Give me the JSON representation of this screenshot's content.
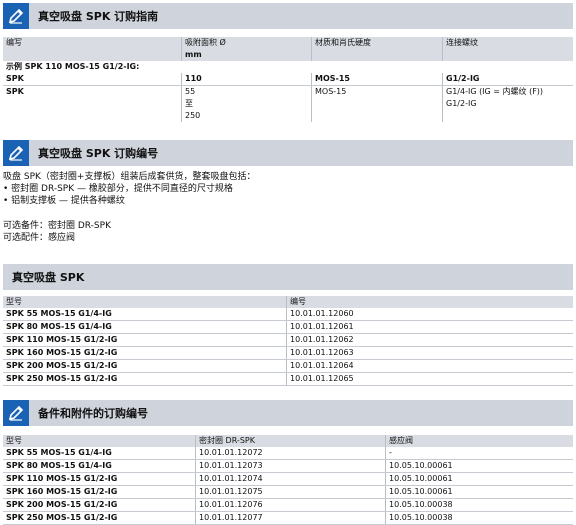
{
  "s1": {
    "title": "真空吸盘 SPK 订购指南",
    "headers": [
      "编写",
      "吸附面积 Ø",
      "材质和肖氏硬度",
      "连接螺纹"
    ],
    "header_unit": "mm",
    "example_label": "示例 SPK 110 MOS-15 G1/2-IG:",
    "example_row": [
      "SPK",
      "110",
      "MOS-15",
      "G1/2-IG"
    ],
    "spec_row": {
      "c1": "SPK",
      "c2": [
        "55",
        "至",
        "250"
      ],
      "c3": "MOS-15",
      "c4": [
        "G1/4-IG (IG = 内螺纹 (F))",
        "G1/2-IG"
      ]
    }
  },
  "s2": {
    "title": "真空吸盘 SPK 订购编号",
    "intro": "吸盘 SPK（密封圈+支撑板）组装后成套供货，整套吸盘包括：",
    "bullets": [
      "• 密封圈 DR-SPK — 橡胶部分，提供不同直径的尺寸规格",
      "• 铝制支撑板 — 提供各种螺纹"
    ],
    "spare": "可选备件：密封圈 DR-SPK",
    "accessory": "可选配件：感应阀"
  },
  "s3": {
    "title": "真空吸盘 SPK",
    "headers": [
      "型号",
      "编号"
    ],
    "rows": [
      [
        "SPK 55 MOS-15 G1/4-IG",
        "10.01.01.12060"
      ],
      [
        "SPK 80 MOS-15 G1/4-IG",
        "10.01.01.12061"
      ],
      [
        "SPK 110 MOS-15 G1/2-IG",
        "10.01.01.12062"
      ],
      [
        "SPK 160 MOS-15 G1/2-IG",
        "10.01.01.12063"
      ],
      [
        "SPK 200 MOS-15 G1/2-IG",
        "10.01.01.12064"
      ],
      [
        "SPK 250 MOS-15 G1/2-IG",
        "10.01.01.12065"
      ]
    ]
  },
  "s4": {
    "title": "备件和附件的订购编号",
    "headers": [
      "型号",
      "密封圈 DR-SPK",
      "感应阀"
    ],
    "rows": [
      [
        "SPK 55 MOS-15 G1/4-IG",
        "10.01.01.12072",
        "-"
      ],
      [
        "SPK 80 MOS-15 G1/4-IG",
        "10.01.01.12073",
        "10.05.10.00061"
      ],
      [
        "SPK 110 MOS-15 G1/2-IG",
        "10.01.01.12074",
        "10.05.10.00061"
      ],
      [
        "SPK 160 MOS-15 G1/2-IG",
        "10.01.01.12075",
        "10.05.10.00061"
      ],
      [
        "SPK 200 MOS-15 G1/2-IG",
        "10.01.01.12076",
        "10.05.10.00038"
      ],
      [
        "SPK 250 MOS-15 G1/2-IG",
        "10.01.01.12077",
        "10.05.10.00038"
      ]
    ]
  },
  "colors": {
    "icon_bg": "#1a63b4",
    "header_band": "#cfd4dc",
    "table_header": "#d9dde3"
  },
  "icons": {
    "section": "pencil-icon"
  }
}
